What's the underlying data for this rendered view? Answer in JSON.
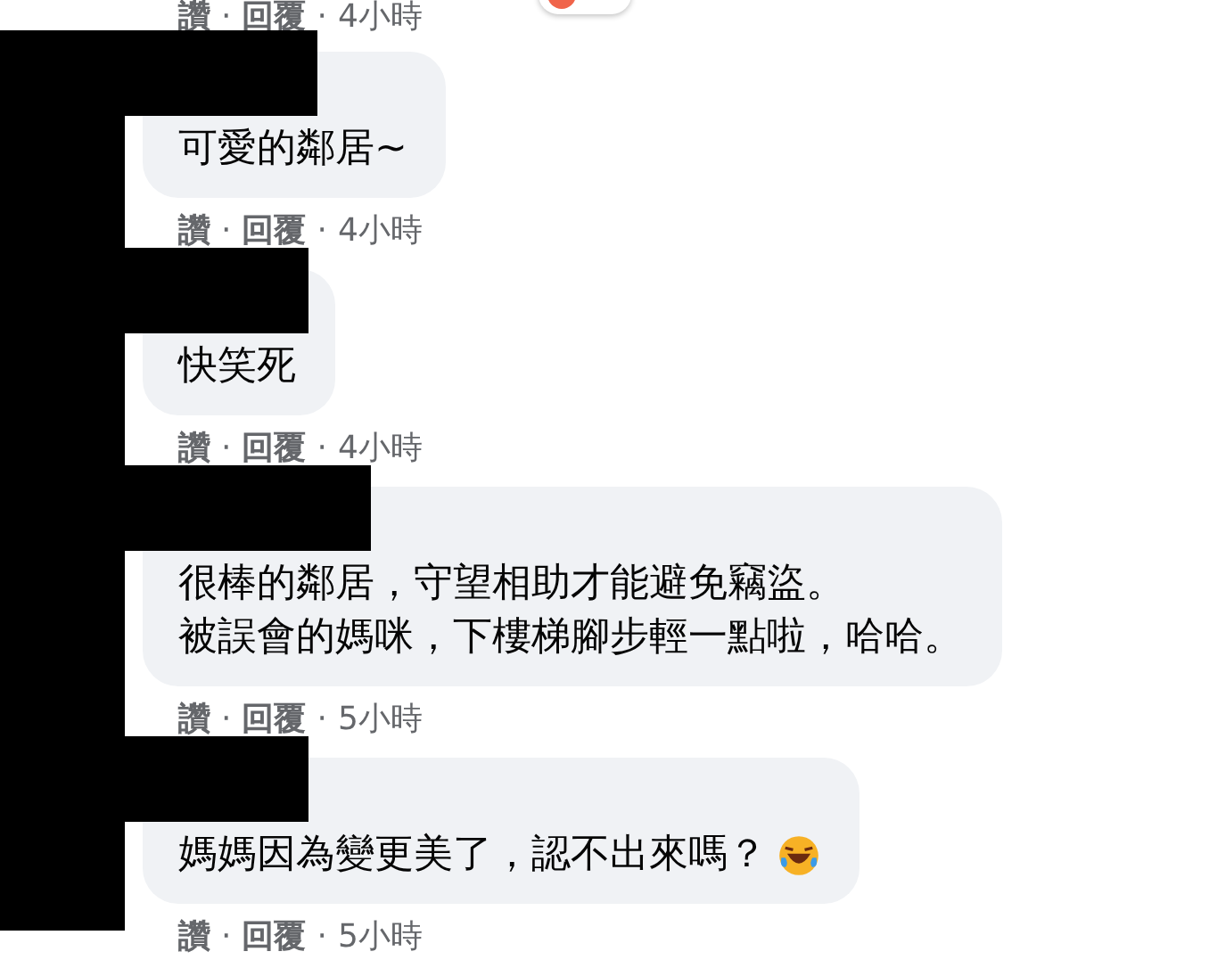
{
  "top_meta": {
    "like": "讚",
    "sep1": "·",
    "reply": "回覆",
    "sep2": "·",
    "time": "4小時"
  },
  "comments": [
    {
      "lines": [
        "可愛的鄰居~"
      ],
      "laughing_emoji": false,
      "like": "讚",
      "sep1": "·",
      "reply": "回覆",
      "sep2": "·",
      "time": "4小時"
    },
    {
      "lines": [
        "快笑死"
      ],
      "laughing_emoji": false,
      "like": "讚",
      "sep1": "·",
      "reply": "回覆",
      "sep2": "·",
      "time": "4小時"
    },
    {
      "lines": [
        "很棒的鄰居，守望相助才能避免竊盜。",
        "被誤會的媽咪，下樓梯腳步輕一點啦，哈哈。"
      ],
      "laughing_emoji": false,
      "like": "讚",
      "sep1": "·",
      "reply": "回覆",
      "sep2": "·",
      "time": "5小時"
    },
    {
      "lines": [
        "媽媽因為變更美了，認不出來嗎？"
      ],
      "laughing_emoji": true,
      "like": "讚",
      "sep1": "·",
      "reply": "回覆",
      "sep2": "·",
      "time": "5小時"
    }
  ]
}
